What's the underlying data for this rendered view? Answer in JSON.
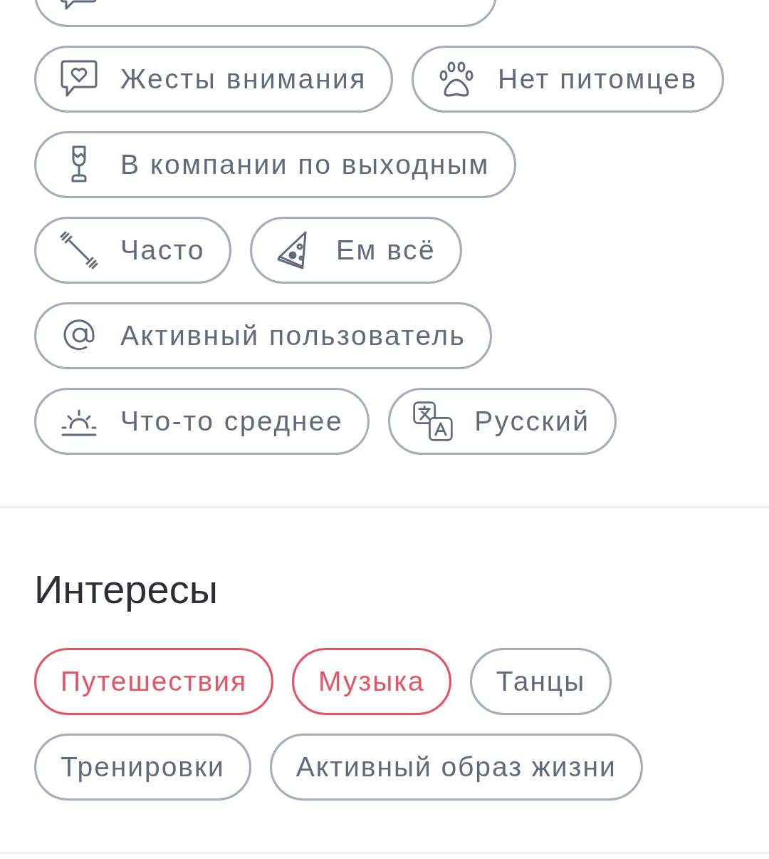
{
  "characteristics": [
    [
      {
        "label": "Жесты внимания"
      },
      {
        "label": "Нет питомцев"
      }
    ],
    [
      {
        "label": "В компании по выходным"
      }
    ],
    [
      {
        "label": "Часто"
      },
      {
        "label": "Ем всё"
      }
    ],
    [
      {
        "label": "Активный пользователь"
      }
    ],
    [
      {
        "label": "Что-то среднее"
      },
      {
        "label": "Русский"
      }
    ]
  ],
  "interests": {
    "title": "Интересы",
    "items": [
      [
        {
          "label": "Путешествия",
          "selected": true
        },
        {
          "label": "Музыка",
          "selected": true
        },
        {
          "label": "Танцы",
          "selected": false
        }
      ],
      [
        {
          "label": "Тренировки",
          "selected": false
        },
        {
          "label": "Активный образ жизни",
          "selected": false
        }
      ]
    ]
  }
}
